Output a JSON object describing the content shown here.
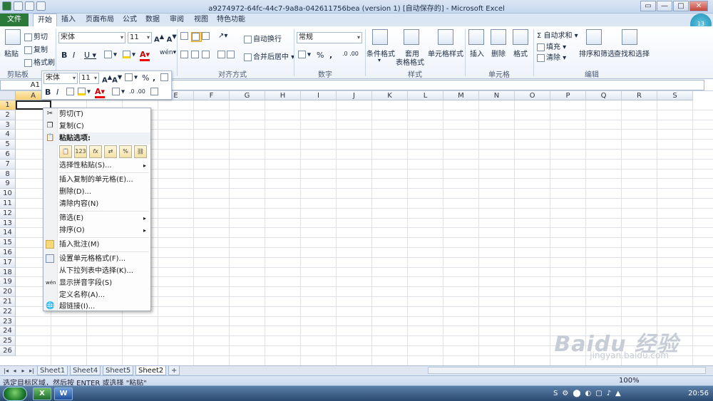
{
  "window": {
    "title": "a9274972-64fc-44c7-9a8a-042611756bea (version 1) [自动保存的] - Microsoft Excel",
    "controls": [
      "▭",
      "—",
      "□",
      "✕"
    ]
  },
  "tabs": [
    "文件",
    "开始",
    "插入",
    "页面布局",
    "公式",
    "数据",
    "审阅",
    "视图",
    "特色功能"
  ],
  "ribbon": {
    "clipboard": {
      "paste": "粘贴",
      "cut": "剪切",
      "copy": "复制",
      "format_painter": "格式刷",
      "label": "剪贴板"
    },
    "font": {
      "name": "宋体",
      "size": "11",
      "label": "字体"
    },
    "alignment": {
      "wrap": "自动换行",
      "merge": "合并后居中",
      "label": "对齐方式"
    },
    "number": {
      "format": "常规",
      "label": "数字"
    },
    "styles": {
      "conditional": "条件格式",
      "table": "套用",
      "table2": "表格格式",
      "cell": "单元格样式",
      "label": "样式"
    },
    "cells": {
      "insert": "插入",
      "delete": "删除",
      "format": "格式",
      "label": "单元格"
    },
    "editing": {
      "autosum": "自动求和",
      "fill": "填充",
      "clear": "清除",
      "sort": "排序和筛选",
      "find": "查找和选择",
      "label": "编辑"
    }
  },
  "formula_bar": {
    "name_box": "A1",
    "value": ""
  },
  "mini_toolbar": {
    "font": "宋体",
    "size": "11",
    "percent": "%",
    "comma": ","
  },
  "columns": [
    "A",
    "B",
    "C",
    "D",
    "E",
    "F",
    "G",
    "H",
    "I",
    "J",
    "K",
    "L",
    "M",
    "N",
    "O",
    "P",
    "Q",
    "R",
    "S"
  ],
  "rows": [
    "1",
    "2",
    "3",
    "4",
    "5",
    "6",
    "7",
    "8",
    "9",
    "10",
    "11",
    "12",
    "13",
    "14",
    "15",
    "16",
    "17",
    "18",
    "19",
    "20",
    "21",
    "22",
    "23",
    "24",
    "25",
    "26"
  ],
  "context_menu": {
    "cut": "剪切(T)",
    "copy": "复制(C)",
    "paste_options": "粘贴选项:",
    "paste_special": "选择性粘贴(S)...",
    "insert_copied": "插入复制的单元格(E)...",
    "delete": "删除(D)...",
    "clear": "清除内容(N)",
    "filter": "筛选(E)",
    "sort": "排序(O)",
    "comment": "插入批注(M)",
    "format_cells": "设置单元格格式(F)...",
    "pick_list": "从下拉列表中选择(K)...",
    "phonetic": "显示拼音字段(S)",
    "define_name": "定义名称(A)...",
    "hyperlink": "超链接(I)..."
  },
  "paste_icons": [
    "📋",
    "123",
    "fx",
    "⇄",
    "%",
    "⛓"
  ],
  "sheets": [
    "Sheet1",
    "Sheet4",
    "Sheet5",
    "Sheet2"
  ],
  "active_sheet": "Sheet2",
  "status": {
    "text": "选定目标区域，然后按 ENTER 或选择 \"粘贴\"",
    "zoom": "100%"
  },
  "taskbar": {
    "clock": "20:56"
  },
  "watermark": {
    "brand": "Baidu 经验",
    "url": "jingyan.baidu.com"
  }
}
